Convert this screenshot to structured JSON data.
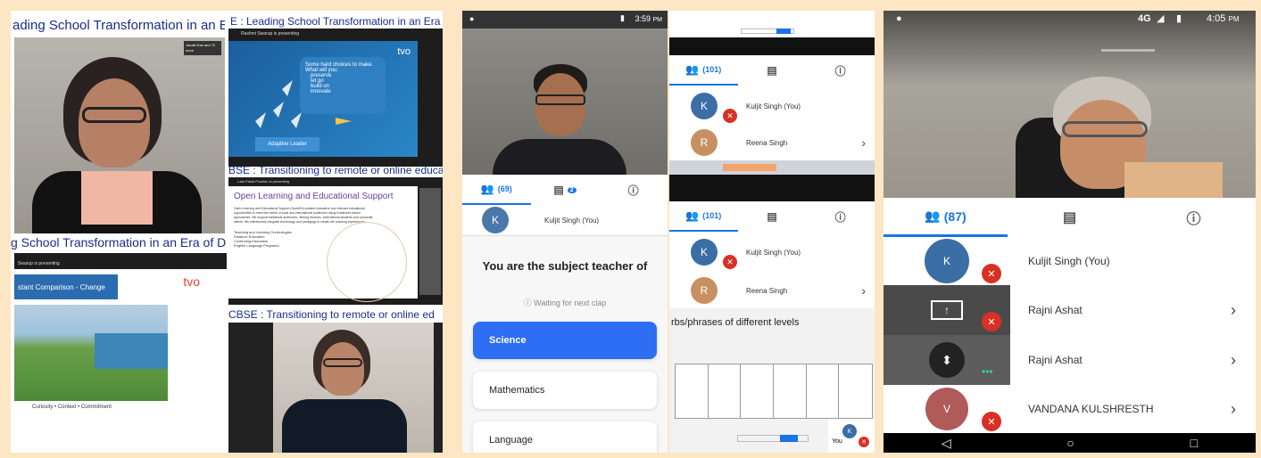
{
  "collage": {
    "panel1": {
      "tl_title": "ading School Transformation in an Era",
      "tl_badge": "Janaki Das and 70 more",
      "tr_title": "E : Leading School Transformation in an Era of Digital Lear",
      "tr_presenting": "Rashmi Swarup is presenting",
      "slide1": {
        "brand": "tvo",
        "text": "Some hard choices to make. What will you:",
        "bullets": [
          "preserve",
          "let go",
          "build on",
          "innovate"
        ],
        "button": "Adaptive Leader"
      },
      "ml_title": "g School Transformation in an Era of D",
      "mr_title": "BSE : Transitioning to remote or online educa",
      "mr_presenting": "Lata Pasta Pushkin is presenting",
      "slide2": {
        "title": "Open Learning and Educational Support",
        "body": "Open Learning and Educational Support (OpenEd) creates innovative and relevant educational opportunities to meet the needs of local and international audiences using evidenced based approaches. We support traditional audiences, lifelong learners, international students and corporate clients. We intentionally integrate technology and pedagogy to create rich learning experiences.",
        "bullets": [
          "Teaching and Learning Technologies",
          "Distance Education",
          "Continuing Education",
          "English Language Programs"
        ]
      },
      "bl_presenting": "Swarup is presenting",
      "slide3": {
        "header": "stant Comparison - Change",
        "brand": "tvo",
        "footer": "Curiosity • Context • Commitment"
      },
      "br_title": "CBSE : Transitioning to remote or online ed"
    },
    "panel2": {
      "status_time": "3:59",
      "status_ampm": "PM",
      "tabs": {
        "people_count": "(69)",
        "chat_badge": "2"
      },
      "you_row": "Kuljit Singh (You)",
      "quiz": {
        "title": "You are the subject teacher of",
        "waiting": "Waiting for next clap",
        "options": [
          "Science",
          "Mathematics",
          "Language"
        ]
      }
    },
    "panel3": {
      "top_tabs_count": "(101)",
      "top_rows": [
        "Kuljit Singh (You)",
        "Reena Singh"
      ],
      "bottom_tabs_count": "(101)",
      "bottom_rows": [
        "Kuljit Singh (You)",
        "Reena Singh"
      ],
      "slide_title": "rbs/phrases of different levels",
      "you_label": "You"
    },
    "panel4": {
      "status_network": "4G",
      "status_time": "4:05",
      "status_ampm": "PM",
      "people_count": "(87)",
      "participants": [
        "Kuljit Singh (You)",
        "Rajni Ashat",
        "Rajni Ashat",
        "VANDANA KULSHRESTH"
      ]
    }
  },
  "colors": {
    "accent": "#1a73e8",
    "mute": "#d93025",
    "background": "#fde6c4"
  }
}
